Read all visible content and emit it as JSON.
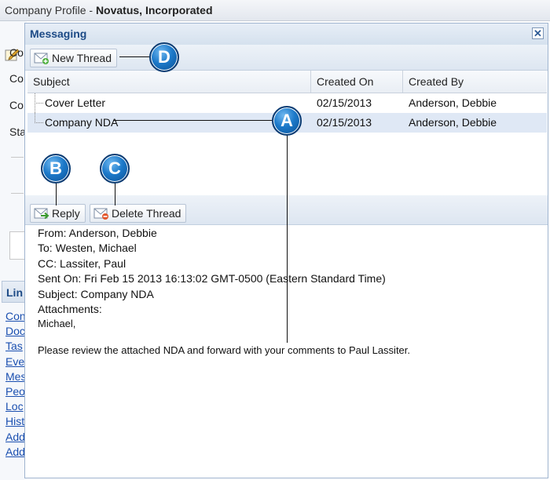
{
  "page": {
    "title_prefix": "Company Profile - ",
    "title_company": "Novatus, Incorporated",
    "left_labels": [
      "Co",
      "Co",
      "Co",
      "Sta"
    ],
    "links_header": "Lin",
    "links": [
      "Con",
      "Doc",
      "Tas",
      "Eve",
      "Mes",
      "Peo",
      "Loc",
      "Hist",
      "Add",
      "Add"
    ]
  },
  "dialog": {
    "title": "Messaging",
    "close_symbol": "✕",
    "new_thread_label": "New Thread",
    "reply_label": "Reply",
    "delete_thread_label": "Delete Thread"
  },
  "grid": {
    "columns": [
      "Subject",
      "Created On",
      "Created By"
    ],
    "rows": [
      {
        "subject": "Cover Letter",
        "created_on": "02/15/2013",
        "created_by": "Anderson, Debbie"
      },
      {
        "subject": "Company NDA",
        "created_on": "02/15/2013",
        "created_by": "Anderson, Debbie"
      }
    ]
  },
  "message": {
    "from": "From:  Anderson, Debbie",
    "to": "To:  Westen, Michael",
    "cc": "CC:  Lassiter, Paul",
    "sent_on": "Sent On:  Fri Feb 15 2013 16:13:02 GMT-0500 (Eastern Standard Time)",
    "subject": "Subject:  Company NDA",
    "attachments": "Attachments:",
    "greeting": "Michael,",
    "body": "Please review the attached NDA and forward with your comments to Paul Lassiter."
  },
  "callouts": {
    "a": "A",
    "b": "B",
    "c": "C",
    "d": "D"
  },
  "colors": {
    "header_text": "#1c4a86",
    "callout": "#1c79c9",
    "link": "#1a4fb0"
  }
}
